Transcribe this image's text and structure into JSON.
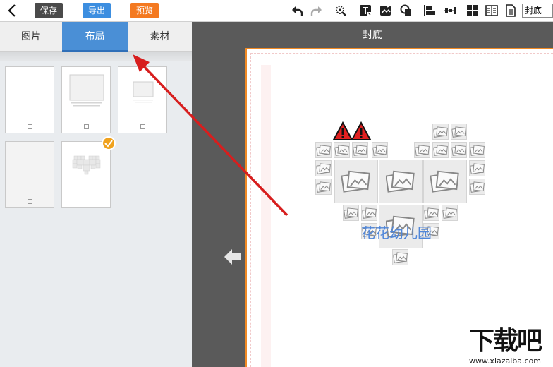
{
  "toolbar": {
    "save_label": "保存",
    "export_label": "导出",
    "preview_label": "预览",
    "page_select_value": "封底",
    "colors": {
      "save": "#4a4a4a",
      "export": "#3c8ee0",
      "preview": "#f47920"
    },
    "icons": [
      "undo-icon",
      "redo-icon",
      "magic-select-icon",
      "text-icon",
      "edit-image-icon",
      "shape-icon",
      "align-left-icon",
      "distribute-icon",
      "grid-layout-icon",
      "two-page-icon",
      "single-page-icon"
    ]
  },
  "left_panel": {
    "tabs": [
      {
        "label": "图片"
      },
      {
        "label": "布局"
      },
      {
        "label": "素材"
      }
    ],
    "active_tab": "布局"
  },
  "canvas": {
    "page_label": "封底",
    "title_text": "花花幼儿园",
    "accent_color": "#f08a24"
  },
  "watermark": {
    "url": "www.xiazaiba.com"
  }
}
